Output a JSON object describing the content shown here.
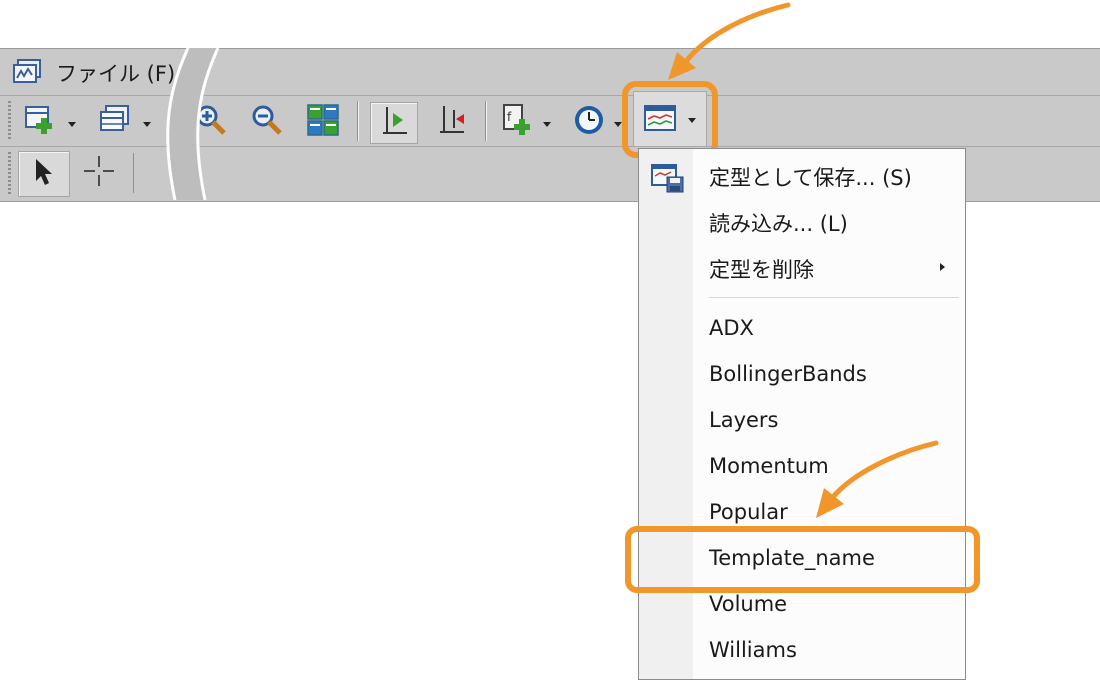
{
  "menubar": {
    "file_menu": "ファイル (F)"
  },
  "toolbar": {
    "buttons": [
      "new-chart-icon",
      "chart-window-icon",
      "zoom-in-icon",
      "zoom-out-icon",
      "tile-windows-icon",
      "chart-shift-icon",
      "autoscroll-icon",
      "indicators-icon",
      "period-clock-icon",
      "template-icon"
    ],
    "tools": [
      "cursor-icon",
      "crosshair-icon"
    ]
  },
  "template_menu": {
    "save_as": "定型として保存... (S)",
    "load": "読み込み... (L)",
    "delete": "定型を削除",
    "templates": [
      "ADX",
      "BollingerBands",
      "Layers",
      "Momentum",
      "Popular",
      "Template_name",
      "Volume",
      "Williams"
    ]
  },
  "colors": {
    "highlight": "#f0962a",
    "toolbar_bg": "#c9c9c9"
  }
}
